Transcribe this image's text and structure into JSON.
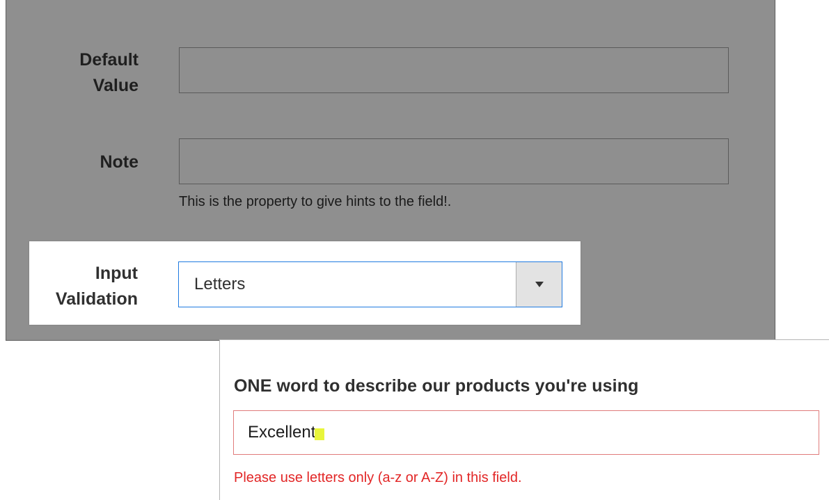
{
  "admin_form": {
    "default_value": {
      "label_line1": "Default",
      "label_line2": "Value",
      "value": ""
    },
    "note": {
      "label": "Note",
      "value": "",
      "hint": "This is the property to give hints to the field!."
    },
    "input_validation": {
      "label_line1": "Input",
      "label_line2": "Validation",
      "selected": "Letters"
    },
    "colors": {
      "panel_bg": "#8f8f8f",
      "focus_border": "#1f7ae0"
    }
  },
  "preview": {
    "question": "ONE word to describe our products you're using",
    "answer": "Excellent.",
    "error": "Please use letters only (a-z or A-Z) in this field.",
    "colors": {
      "error": "#e22626",
      "error_border": "#e07b7b",
      "highlight": "#e8f53b"
    }
  }
}
